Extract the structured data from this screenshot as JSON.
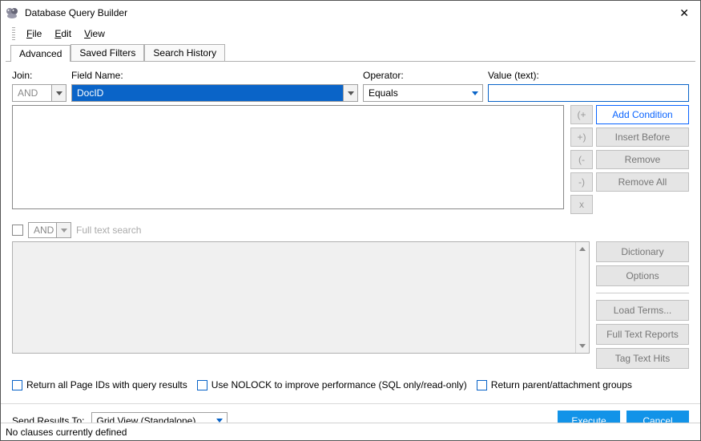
{
  "window": {
    "title": "Database Query Builder"
  },
  "menu": {
    "file": "File",
    "edit": "Edit",
    "view": "View"
  },
  "tabs": {
    "advanced": "Advanced",
    "saved": "Saved Filters",
    "history": "Search History"
  },
  "labels": {
    "join": "Join:",
    "field": "Field Name:",
    "operator": "Operator:",
    "value": "Value (text):",
    "fulltext": "Full text search",
    "sendResults": "Send Results To:"
  },
  "inputs": {
    "join": "AND",
    "field": "DocID",
    "operator": "Equals",
    "value": "",
    "ftsJoin": "AND",
    "resultsTarget": "Grid View (Standalone)"
  },
  "buttons": {
    "openParen": "(+",
    "closeParen": "+)",
    "openParenMinus": "(-",
    "closeParenMinus": "-)",
    "x": "x",
    "addCondition": "Add Condition",
    "insertBefore": "Insert Before",
    "remove": "Remove",
    "removeAll": "Remove All",
    "dictionary": "Dictionary",
    "options": "Options",
    "loadTerms": "Load Terms...",
    "fullTextReports": "Full Text Reports",
    "tagTextHits": "Tag Text Hits",
    "execute": "Execute",
    "cancel": "Cancel"
  },
  "checkboxes": {
    "returnPageIds": "Return all Page IDs with query results",
    "useNolock": "Use NOLOCK to improve performance (SQL only/read-only)",
    "returnParent": "Return parent/attachment groups"
  },
  "status": "No clauses currently defined"
}
